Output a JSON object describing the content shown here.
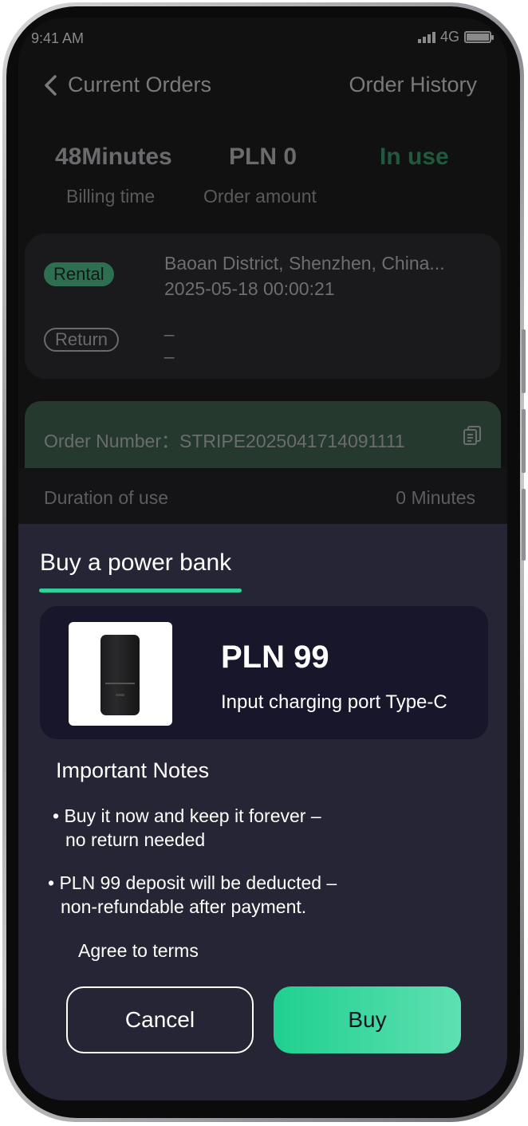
{
  "status_bar": {
    "time": "9:41 AM",
    "network": "4G"
  },
  "nav": {
    "title": "Current Orders",
    "history": "Order History"
  },
  "stats": {
    "billing_value": "48Minutes",
    "billing_label": "Billing time",
    "amount_value": "PLN 0",
    "amount_label": "Order amount",
    "status": "In use"
  },
  "locations": {
    "rental_label": "Rental",
    "rental_address": "Baoan District, Shenzhen, China...",
    "rental_time": "2025-05-18 00:00:21",
    "return_label": "Return",
    "return_address": "_",
    "return_time": "_"
  },
  "order": {
    "number_label": "Order Number：STRIPE2025041714091111"
  },
  "duration": {
    "label": "Duration of use",
    "value": "0 Minutes"
  },
  "sheet": {
    "title": "Buy a power bank",
    "price": "PLN 99",
    "port": "Input charging port Type-C",
    "notes_title": "Important Notes",
    "note1_line1": "• Buy it now and keep it forever –",
    "note1_line2": "no return needed",
    "note2_line1": "• PLN 99 deposit will be deducted –",
    "note2_line2": "non-refundable after payment.",
    "agree": "Agree to terms",
    "cancel": "Cancel",
    "buy": "Buy"
  },
  "colors": {
    "accent": "#2fd39a",
    "sheet_bg": "#262535",
    "screen_bg": "#111112"
  }
}
